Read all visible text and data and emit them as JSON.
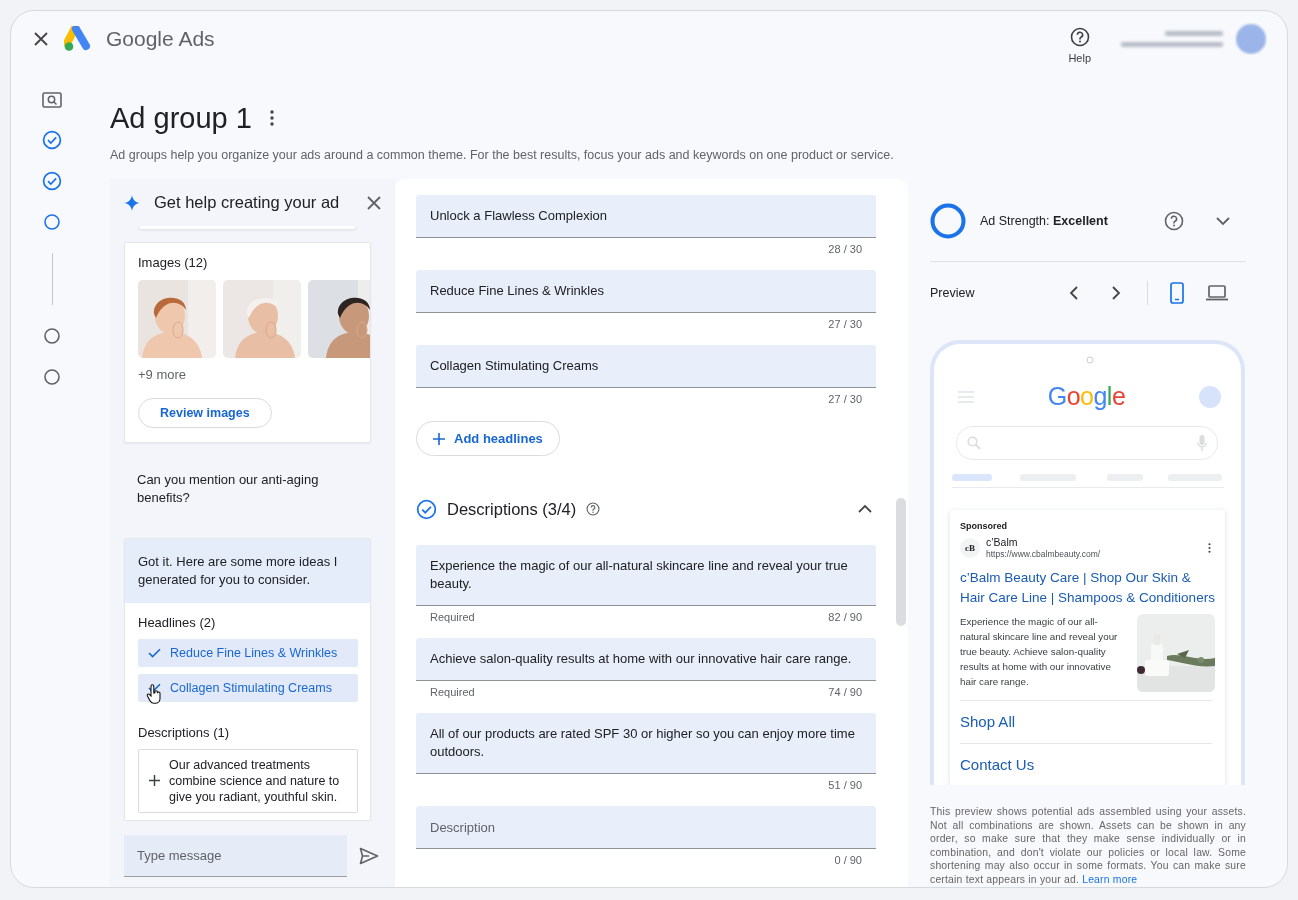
{
  "app": {
    "title": "Google Ads",
    "help_label": "Help"
  },
  "steps": [
    {
      "kind": "review"
    },
    {
      "kind": "done"
    },
    {
      "kind": "done"
    },
    {
      "kind": "current"
    },
    {
      "kind": "todo"
    },
    {
      "kind": "todo"
    }
  ],
  "page": {
    "title": "Ad group 1",
    "subtitle": "Ad groups help you organize your ads around a common theme. For the best results, focus your ads and keywords on one product or service."
  },
  "assistant": {
    "title": "Get help creating your ad",
    "images_label": "Images (12)",
    "more_label": "+9 more",
    "review_button": "Review images",
    "user_message": "Can you mention our anti-aging benefits?",
    "reply": "Got it. Here are some more ideas I generated for you to consider.",
    "headlines_label": "Headlines (2)",
    "headline_ideas": [
      {
        "text": "Reduce Fine Lines & Wrinkles",
        "checked": true
      },
      {
        "text": "Collagen Stimulating Creams",
        "checked": true
      }
    ],
    "descriptions_label": "Descriptions (1)",
    "description_ideas": [
      {
        "text": "Our advanced treatments combine science and nature to give you radiant, youthful skin.",
        "checked": false
      }
    ],
    "input_placeholder": "Type message"
  },
  "editor": {
    "headlines": [
      {
        "value": "Unlock a Flawless Complexion",
        "counter": "28 / 30"
      },
      {
        "value": "Reduce Fine Lines & Wrinkles",
        "counter": "27 / 30"
      },
      {
        "value": "Collagen Stimulating Creams",
        "counter": "27 / 30"
      }
    ],
    "add_headlines": "Add headlines",
    "descriptions_title": "Descriptions (3/4)",
    "descriptions_complete": true,
    "expanded": true,
    "descriptions": [
      {
        "value": "Experience the magic of our all-natural skincare line and reveal your true beauty.",
        "note": "Required",
        "counter": "82 / 90"
      },
      {
        "value": "Achieve salon-quality results at home with our innovative hair care range.",
        "note": "Required",
        "counter": "74 / 90"
      },
      {
        "value": "All of our products are rated SPF 30 or higher so you can enjoy more time outdoors.",
        "counter": "51 / 90"
      },
      {
        "placeholder": "Description",
        "counter": "0 / 90"
      }
    ]
  },
  "preview": {
    "level": 1,
    "strength_label": "Ad Strength: **Excellent**",
    "strength_expanded": false,
    "preview_label": "Preview",
    "devices": [
      {
        "kind": "mobile",
        "selected": true
      },
      {
        "kind": "desktop",
        "selected": false
      }
    ],
    "search_logo": "Google",
    "ad": {
      "sponsored": "Sponsored",
      "brand_logo": "cB",
      "advertiser": "c’Balm",
      "url": "https://www.cbalmbeauty.com/",
      "headline": "c’Balm Beauty Care | Shop Our Skin & Hair Care Line | Shampoos & Conditioners",
      "description": "Experience the magic of our all-natural skincare line and reveal your true beauty. Achieve salon-quality results at home with our innovative hair care range.",
      "sitelinks": [
        "Shop All",
        "Contact Us"
      ]
    },
    "disclaimer": "This preview shows potential ads assembled using your assets. Not all combinations are shown. Assets can be shown in any order, so make sure that they make sense individually or in combination, and don't violate our policies or local law. Some shortening may also occur in some formats. You can make sure certain text appears in your ad.",
    "learn_more": "Learn more"
  }
}
